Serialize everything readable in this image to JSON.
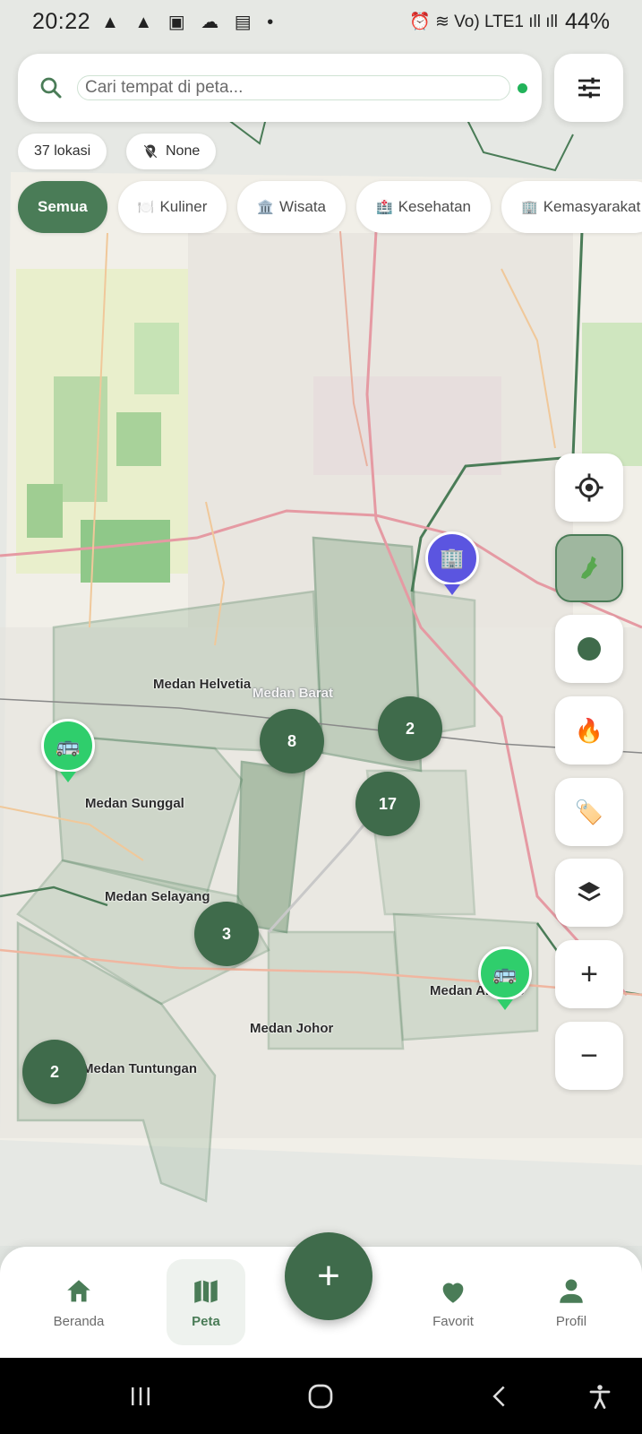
{
  "status_bar": {
    "time": "20:22",
    "left_icons": "▲ ▲ ▣ ☁ ▤ •",
    "right_icons": "⏰ ≋ Vo) LTE1 ıll ıll",
    "battery": "44%"
  },
  "search": {
    "placeholder": "Cari tempat di peta..."
  },
  "info_chips": {
    "location_count": "37 lokasi",
    "nearby_filter": "None"
  },
  "categories": [
    {
      "label": "Semua",
      "emoji": "",
      "active": true
    },
    {
      "label": "Kuliner",
      "emoji": "🍽️",
      "active": false
    },
    {
      "label": "Wisata",
      "emoji": "🏛️",
      "active": false
    },
    {
      "label": "Kesehatan",
      "emoji": "🏥",
      "active": false
    },
    {
      "label": "Kemasyarakat",
      "emoji": "🏢",
      "active": false
    }
  ],
  "tools": {
    "heatmap_emoji": "🔥",
    "tag_emoji": "🏷️",
    "zoom_in": "+",
    "zoom_out": "−"
  },
  "map": {
    "districts": {
      "helvetia": "Medan Helvetia",
      "barat": "Medan Barat",
      "sunggal": "Medan Sunggal",
      "selayang": "Medan Selayang",
      "johor": "Medan Johor",
      "tuntungan": "Medan Tuntungan",
      "amplas": "Medan Amplas"
    },
    "clusters": {
      "c1": "8",
      "c2": "2",
      "c3": "17",
      "c4": "3",
      "c5": "2"
    },
    "pins": {
      "bus_west": "🚌",
      "bus_east": "🚌",
      "building": "🏢"
    }
  },
  "bottom_nav": {
    "home": "Beranda",
    "map": "Peta",
    "favorites": "Favorit",
    "profile": "Profil",
    "fab": "+"
  },
  "colors": {
    "primary": "#4a7c57",
    "primary_dark": "#3f6b4b",
    "pin_green": "#2fce6c",
    "pin_blue": "#5b55e0"
  }
}
